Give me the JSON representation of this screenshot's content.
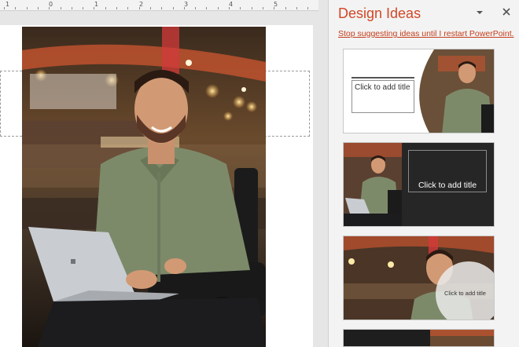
{
  "ruler": {
    "numbers": [
      "1",
      "0",
      "1",
      "2",
      "3",
      "4",
      "5"
    ]
  },
  "design_pane": {
    "title": "Design Ideas",
    "stop_link": "Stop suggesting ideas until I restart PowerPoint.",
    "thumbnails": [
      {
        "placeholder": "Click to add title"
      },
      {
        "placeholder": "Click to add title"
      },
      {
        "placeholder": "Click to add title"
      }
    ]
  },
  "icons": {
    "menu": "chevron-down-icon",
    "close": "close-icon"
  },
  "colors": {
    "pane_title": "#d24726",
    "link": "#c43e1c",
    "pane_bg": "#f3f3f3"
  }
}
